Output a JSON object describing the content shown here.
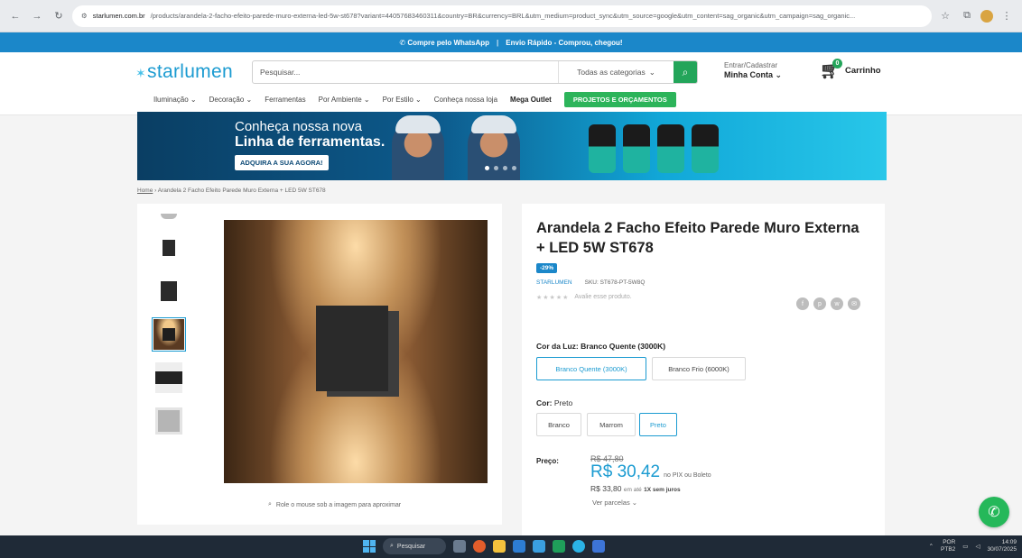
{
  "browser": {
    "url_host": "starlumen.com.br",
    "url_path": "/products/arandela-2-facho-efeito-parede-muro-externa-led-5w-st678?variant=44057683460311&country=BR&currency=BRL&utm_medium=product_sync&utm_source=google&utm_content=sag_organic&utm_campaign=sag_organic..."
  },
  "promo": {
    "whatsapp": "Compre pelo WhatsApp",
    "separator": "|",
    "shipping": "Envio Rápido - Comprou, chegou!"
  },
  "header": {
    "logo": "starlumen",
    "search_placeholder": "Pesquisar...",
    "category_select": "Todas as categorias",
    "account_top": "Entrar/Cadastrar",
    "account_main": "Minha Conta",
    "cart_label": "Carrinho",
    "cart_count": "0"
  },
  "nav": {
    "items": [
      "Iluminação",
      "Decoração",
      "Ferramentas",
      "Por Ambiente",
      "Por Estilo",
      "Conheça nossa loja",
      "Mega Outlet"
    ],
    "cta": "PROJETOS E ORÇAMENTOS"
  },
  "banner": {
    "line1": "Conheça nossa nova",
    "line2": "Linha de ferramentas.",
    "button": "ADQUIRA A SUA AGORA!"
  },
  "breadcrumb": {
    "home": "Home",
    "current": "› Arandela 2 Facho Efeito Parede Muro Externa + LED 5W ST678"
  },
  "gallery": {
    "zoom_hint": "Role o mouse sob a imagem para aproximar"
  },
  "product": {
    "title": "Arandela 2 Facho Efeito Parede Muro Externa + LED 5W ST678",
    "discount_badge": "-29%",
    "brand": "STARLUMEN",
    "sku": "SKU: ST678-PT-5W8Q",
    "review_cta": "Avalie esse produto.",
    "stars": "★★★★★",
    "light_color_label": "Cor da Luz:",
    "light_color_value": "Branco Quente (3000K)",
    "light_options": [
      "Branco Quente (3000K)",
      "Branco Frio (6000K)"
    ],
    "color_label": "Cor:",
    "color_value": "Preto",
    "color_options": [
      "Branco",
      "Marrom",
      "Preto"
    ],
    "price_label": "Preço:",
    "old_price": "R$ 47,80",
    "new_price": "R$ 30,42",
    "new_price_suffix": "no PIX ou Boleto",
    "installment_price": "R$ 33,80",
    "installment_pre": "em até",
    "installment_strong": "1X sem juros",
    "installments_link": "Ver parcelas"
  },
  "taskbar": {
    "search": "Pesquisar",
    "lang1": "POR",
    "lang2": "PTB2",
    "time": "14:09",
    "date": "30/07/2025"
  },
  "colors": {
    "brand_blue": "#1b9bd1",
    "promo_blue": "#1b87c9",
    "green": "#23a55a"
  }
}
